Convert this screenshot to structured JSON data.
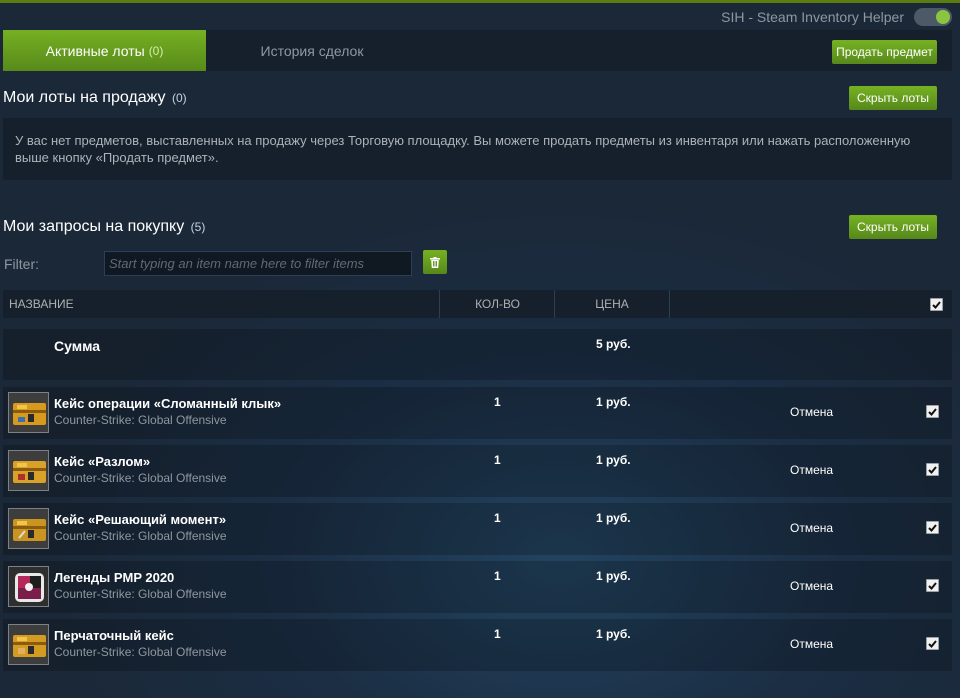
{
  "extension": {
    "name": "SIH - Steam Inventory Helper",
    "enabled": true
  },
  "tabs": [
    {
      "label": "Активные лоты",
      "count": "(0)"
    },
    {
      "label": "История сделок"
    }
  ],
  "sell_button": "Продать предмет",
  "listings": {
    "title": "Мои лоты на продажу",
    "count": "(0)",
    "hide_button": "Скрыть лоты",
    "empty_message": "У вас нет предметов, выставленных на продажу через Торговую площадку. Вы можете продать предметы из инвентаря или нажать расположенную выше кнопку «Продать предмет»."
  },
  "buy_orders": {
    "title": "Мои запросы на покупку",
    "count": "(5)",
    "hide_button": "Скрыть лоты",
    "filter_label": "Filter:",
    "filter_placeholder": "Start typing an item name here to filter items",
    "columns": {
      "name": "НАЗВАНИЕ",
      "qty": "КОЛ-ВО",
      "price": "ЦЕНА"
    },
    "summary": {
      "label": "Сумма",
      "price": "5 руб."
    },
    "items": [
      {
        "name": "Кейс операции «Сломанный клык»",
        "game": "Counter-Strike: Global Offensive",
        "qty": "1",
        "price": "1 руб.",
        "cancel": "Отмена",
        "icon": "case-icon",
        "checked": true
      },
      {
        "name": "Кейс «Разлом»",
        "game": "Counter-Strike: Global Offensive",
        "qty": "1",
        "price": "1 руб.",
        "cancel": "Отмена",
        "icon": "case-icon",
        "checked": true
      },
      {
        "name": "Кейс «Решающий момент»",
        "game": "Counter-Strike: Global Offensive",
        "qty": "1",
        "price": "1 руб.",
        "cancel": "Отмена",
        "icon": "case-icon",
        "checked": true
      },
      {
        "name": "Легенды PMP 2020",
        "game": "Counter-Strike: Global Offensive",
        "qty": "1",
        "price": "1 руб.",
        "cancel": "Отмена",
        "icon": "sticker-capsule-icon",
        "checked": true
      },
      {
        "name": "Перчаточный кейс",
        "game": "Counter-Strike: Global Offensive",
        "qty": "1",
        "price": "1 руб.",
        "cancel": "Отмена",
        "icon": "case-icon",
        "checked": true
      }
    ]
  }
}
